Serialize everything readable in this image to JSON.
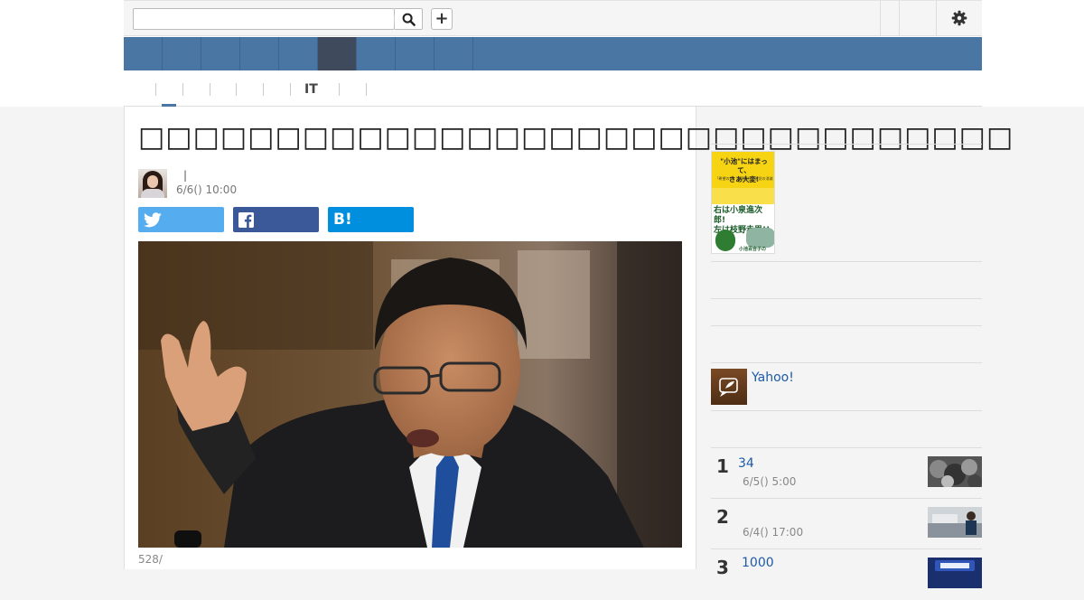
{
  "topbar": {
    "add_label": "+"
  },
  "subnav": {
    "items": [
      "",
      "",
      "",
      "",
      "",
      "IT",
      ""
    ]
  },
  "article": {
    "title": "□□□□□□□□□□□□□□□□□□□□□□□□□□□□□□□□",
    "author_separator": "|",
    "date": "6/6() 10:00",
    "share": {
      "hatena_label": "B!"
    },
    "photo_caption": "528/"
  },
  "sidebar": {
    "book_cover": {
      "title_line": "\"小池\"にはまって、",
      "title_line2": "さあ大変!",
      "subtitle": "「希望の党」の凋落と民進党の消滅",
      "line1": "右は小泉進次郎!",
      "line2": "左は枝野幸男!!",
      "line3": "小池百合子の"
    },
    "yahoo_label": "Yahoo!",
    "ranking": [
      {
        "rank": "1",
        "title": "34",
        "date": "6/5() 5:00"
      },
      {
        "rank": "2",
        "title": "",
        "date": "6/4() 17:00"
      },
      {
        "rank": "3",
        "title": "1000",
        "date": ""
      }
    ]
  },
  "colors": {
    "nav": "#4a76a4",
    "nav_active": "#3f4a5c",
    "twitter": "#55acee",
    "facebook": "#3b5998",
    "hatena": "#008fde",
    "link": "#1d5aa8"
  }
}
